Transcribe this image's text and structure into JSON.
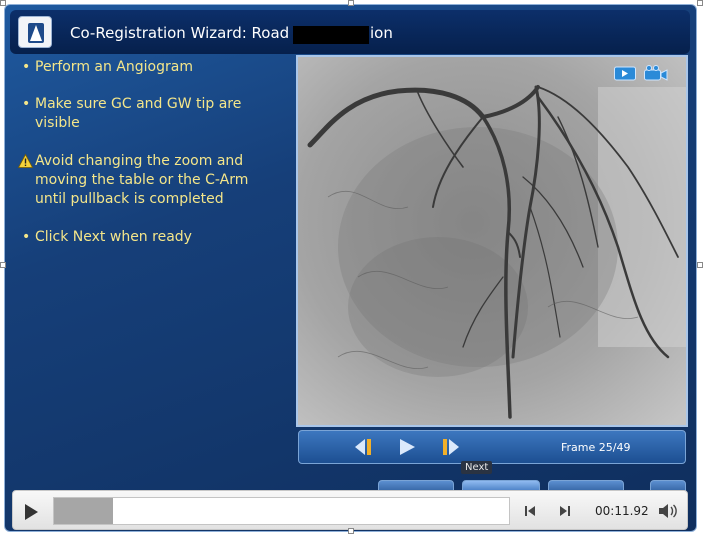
{
  "window": {
    "title_prefix": "Co-Registration Wizard: Road",
    "title_suffix": "ion"
  },
  "instructions": [
    {
      "icon": "bullet",
      "text": "Perform an Angiogram"
    },
    {
      "icon": "bullet",
      "text": "Make sure GC and GW tip are visible"
    },
    {
      "icon": "warning-icon",
      "text": "Avoid changing the zoom and moving the table or the C-Arm until pullback is completed"
    },
    {
      "icon": "bullet",
      "text": "Click Next when ready"
    }
  ],
  "viewer": {
    "frame_label": "Frame 25/49",
    "current_frame": 25,
    "total_frames": 49
  },
  "tooltip": {
    "next": "Next"
  },
  "player": {
    "time": "00:11.92",
    "progress_fraction": 0.13
  },
  "colors": {
    "instruction_text": "#f4e68a",
    "panel_background": "#163f79",
    "title_bar": "#06204c"
  }
}
